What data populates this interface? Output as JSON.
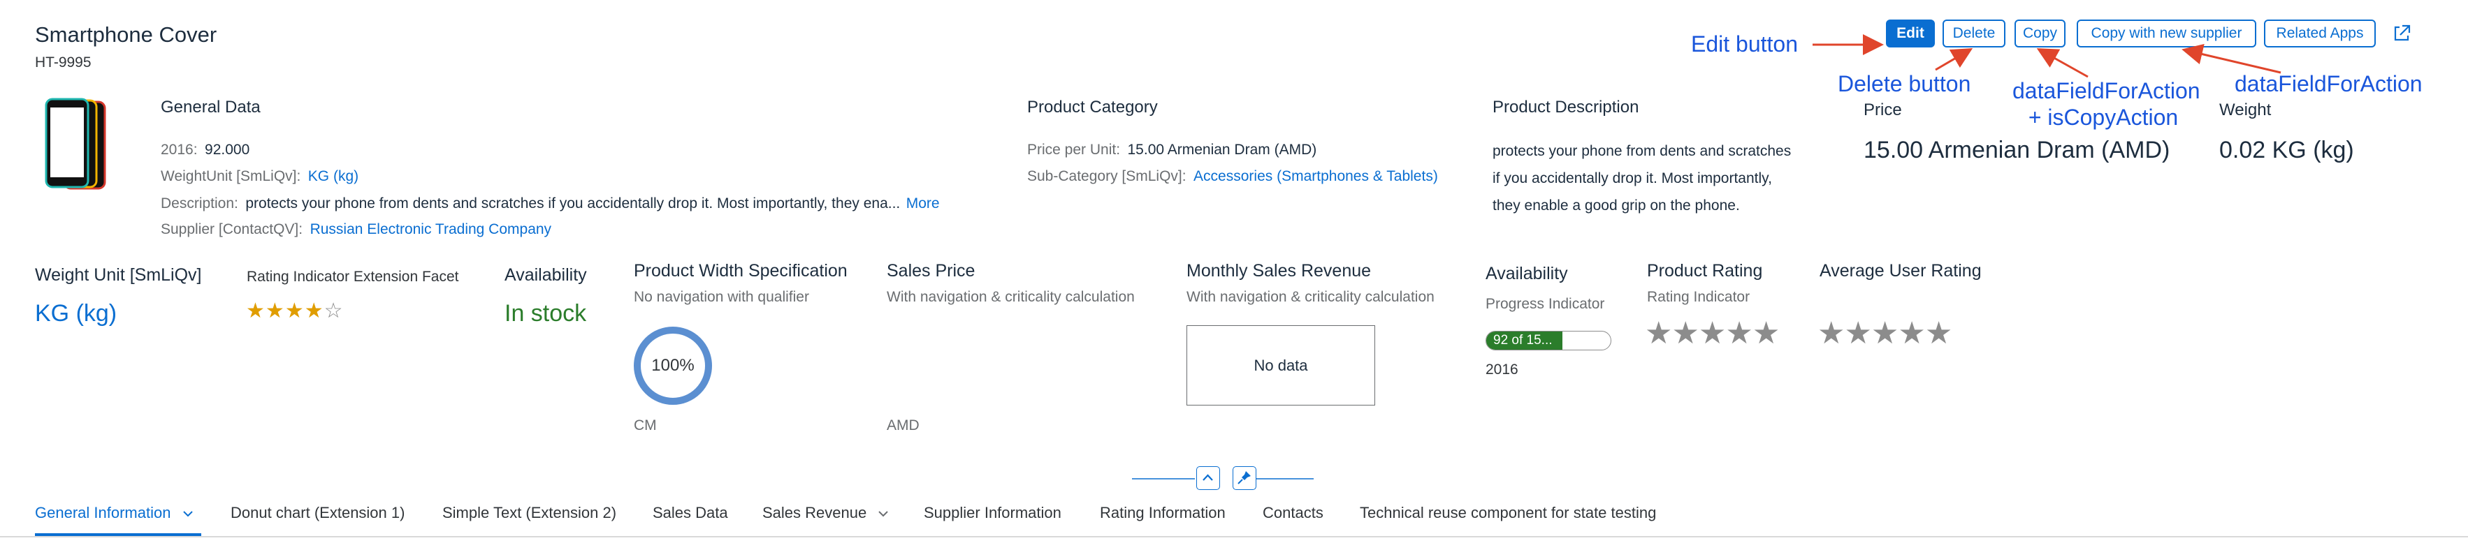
{
  "header": {
    "title": "Smartphone Cover",
    "subtitle": "HT-9995"
  },
  "actions": {
    "edit": "Edit",
    "delete": "Delete",
    "copy": "Copy",
    "copy_new_supplier": "Copy with new supplier",
    "related_apps": "Related Apps"
  },
  "annotations": {
    "edit_button": "Edit button",
    "delete_button": "Delete button",
    "copy_action_line1": "dataFieldForAction",
    "copy_action_line2": "+ isCopyAction",
    "copy_new_supplier_action": "dataFieldForAction",
    "arrow_color": "#e0452b"
  },
  "general_data": {
    "title": "General Data",
    "year_label": "2016:",
    "year_value": "92.000",
    "weight_unit_label": "WeightUnit [SmLiQv]:",
    "weight_unit_value": "KG (kg)",
    "description_label": "Description:",
    "description_value": "protects your phone from dents and scratches if you accidentally drop it. Most importantly, they ena...",
    "more_link": "More",
    "supplier_label": "Supplier [ContactQV]:",
    "supplier_value": "Russian Electronic Trading Company"
  },
  "product_category": {
    "title": "Product Category",
    "price_label": "Price per Unit:",
    "price_value": "15.00  Armenian Dram (AMD)",
    "subcategory_label": "Sub-Category [SmLiQv]:",
    "subcategory_value": "Accessories (Smartphones & Tablets)"
  },
  "product_description": {
    "title": "Product Description",
    "lines": [
      "protects your phone from dents and scratches",
      "if you accidentally drop it. Most importantly,",
      "they enable a good grip on the phone."
    ]
  },
  "key_values": {
    "price_label": "Price",
    "price_value": "15.00  Armenian Dram (AMD)",
    "weight_label": "Weight",
    "weight_value": "0.02 KG (kg)"
  },
  "facets": {
    "weight_unit": {
      "title": "Weight Unit [SmLiQv]",
      "value": "KG (kg)"
    },
    "rating_extension": {
      "title": "Rating Indicator Extension Facet",
      "rating": 4,
      "max": 5
    },
    "availability": {
      "title": "Availability",
      "value": "In stock",
      "color": "#2b7d2b"
    },
    "width_spec": {
      "title": "Product Width Specification",
      "subtitle": "No navigation with qualifier",
      "percent_label": "100%",
      "percent": 100,
      "unit": "CM"
    },
    "sales_price": {
      "title": "Sales Price",
      "subtitle": "With navigation & criticality calculation",
      "unit": "AMD"
    },
    "monthly_revenue": {
      "title": "Monthly Sales Revenue",
      "subtitle": "With navigation & criticality calculation",
      "no_data": "No data"
    },
    "availability_progress": {
      "title": "Availability",
      "subtitle": "Progress Indicator",
      "bar_label": "92 of 15...",
      "fill_fraction": 0.61,
      "year": "2016",
      "color": "#2b7d2b"
    },
    "product_rating": {
      "title": "Product Rating",
      "subtitle": "Rating Indicator",
      "rating": 0,
      "max": 5
    },
    "average_rating": {
      "title": "Average User Rating",
      "rating": 0,
      "max": 5
    }
  },
  "tabs": [
    {
      "label": "General Information",
      "selected": true,
      "dropdown": true
    },
    {
      "label": "Donut chart (Extension 1)"
    },
    {
      "label": "Simple Text (Extension 2)"
    },
    {
      "label": "Sales Data"
    },
    {
      "label": "Sales Revenue",
      "dropdown": true
    },
    {
      "label": "Supplier Information"
    },
    {
      "label": "Rating Information"
    },
    {
      "label": "Contacts"
    },
    {
      "label": "Technical reuse component for state testing"
    }
  ],
  "colors": {
    "accent": "#0a6ed1",
    "positive": "#2b7d2b",
    "star_filled": "#e09d00",
    "star_empty": "#8c8c8c"
  }
}
